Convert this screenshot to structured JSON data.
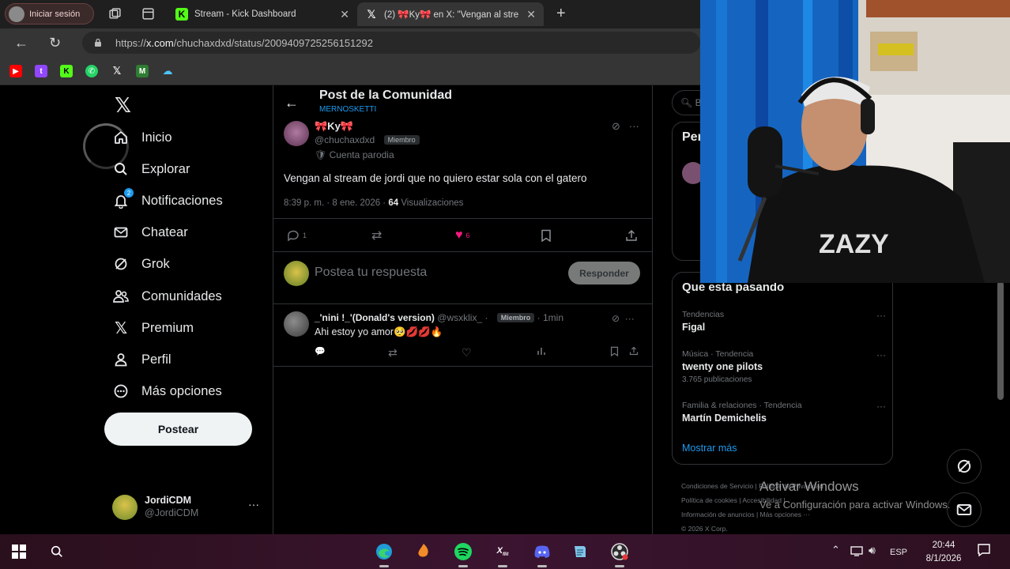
{
  "browser": {
    "profile_label": "Iniciar sesión",
    "tabs": [
      {
        "title": "Stream - Kick Dashboard"
      },
      {
        "title": "(2) 🎀Ky🎀 en X: \"Vengan al stre"
      }
    ],
    "url_domain": "x.com",
    "url_prefix": "https://",
    "url_path": "/chuchaxdxd/status/2009409725256151292"
  },
  "sidebar": {
    "nav": [
      {
        "label": "Inicio"
      },
      {
        "label": "Explorar"
      },
      {
        "label": "Notificaciones",
        "badge": "2"
      },
      {
        "label": "Chatear"
      },
      {
        "label": "Grok"
      },
      {
        "label": "Comunidades"
      },
      {
        "label": "Premium"
      },
      {
        "label": "Perfil"
      },
      {
        "label": "Más opciones"
      }
    ],
    "post_button": "Postear",
    "account": {
      "name": "JordiCDM",
      "handle": "@JordiCDM"
    }
  },
  "main": {
    "header_title": "Post de la Comunidad",
    "header_sub": "MERNOSKETTI",
    "post": {
      "author": "🎀Ky🎀",
      "handle": "@chuchaxdxd",
      "member_chip": "Miembro",
      "parody": "Cuenta parodia",
      "text": "Vengan al stream de jordi que no quiero estar sola con el gatero",
      "timestamp": "8:39 p. m. · 8 ene. 2026 ·",
      "views_count": "64",
      "views_label": "Visualizaciones",
      "replies": "1",
      "likes": "6"
    },
    "reply_box": {
      "placeholder": "Postea tu respuesta",
      "button": "Responder"
    },
    "reply": {
      "author": "_'nini !_'(Donald's version)",
      "handle": "@wsxklix_ ·",
      "member_chip": "Miembro",
      "time": "· 1min",
      "text": "Ahi estoy yo amor🥺💋💋🔥"
    }
  },
  "right": {
    "search_placeholder": "Bu",
    "premium_title": "Per",
    "trends_title": "Que esta pasando",
    "trends": [
      {
        "category": "Tendencias",
        "name": "Figal",
        "count": ""
      },
      {
        "category": "Música · Tendencia",
        "name": "twenty one pilots",
        "count": "3.765 publicaciones"
      },
      {
        "category": "Familia & relaciones · Tendencia",
        "name": "Martín Demichelis",
        "count": ""
      }
    ],
    "show_more": "Mostrar más",
    "footer": [
      "Condiciones de Servicio  |  Política de Privacidad",
      "Política de cookies  |  Accesibilidad  |",
      "Información de anuncios  |  Más opciones ···",
      "© 2026 X Corp."
    ]
  },
  "windows_activation": {
    "title": "Activar Windows",
    "subtitle": "Ve a Configuración para activar Windows."
  },
  "taskbar": {
    "language": "ESP",
    "time": "20:44",
    "date": "8/1/2026"
  }
}
